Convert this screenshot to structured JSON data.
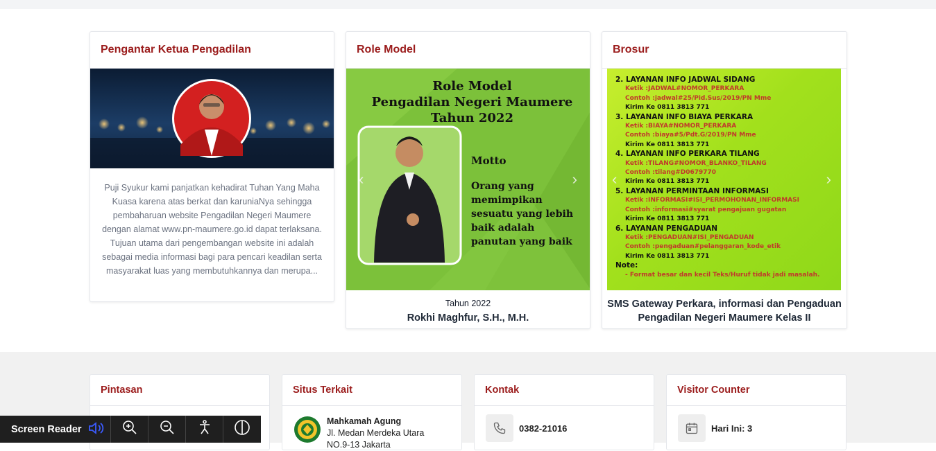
{
  "cards": {
    "pengantar": {
      "title": "Pengantar Ketua Pengadilan",
      "text": "Puji Syukur kami panjatkan kehadirat Tuhan Yang Maha Kuasa karena atas berkat dan karuniaNya sehingga pembaharuan website Pengadilan Negeri Maumere dengan alamat www.pn-maumere.go.id dapat terlaksana. Tujuan utama dari pengembangan website ini adalah sebagai media informasi bagi para pencari keadilan serta masyarakat luas yang membutuhkannya dan merupa..."
    },
    "role_model": {
      "title": "Role Model",
      "banner_line1": "Role Model",
      "banner_line2": "Pengadilan Negeri Maumere",
      "banner_line3": "Tahun 2022",
      "motto_label": "Motto",
      "motto_text": "Orang yang memimpikan sesuatu yang lebih baik adalah panutan yang baik",
      "caption_year": "Tahun 2022",
      "caption_name": "Rokhi Maghfur, S.H., M.H."
    },
    "brosur": {
      "title": "Brosur",
      "lines": [
        "2. LAYANAN INFO JADWAL SIDANG",
        "Ketik     :JADWAL#NOMOR_PERKARA",
        "Contoh  :jadwal#25/Pid.Sus/2019/PN Mme",
        "Kirim Ke 0811 3813 771",
        "3. LAYANAN INFO BIAYA PERKARA",
        "Ketik     :BIAYA#NOMOR_PERKARA",
        "Contoh  :biaya#5/Pdt.G/2019/PN Mme",
        "Kirim Ke 0811 3813 771",
        "4. LAYANAN INFO PERKARA TILANG",
        "Ketik     :TILANG#NOMOR_BLANKO_TILANG",
        "Contoh  :tilang#D0679770",
        "Kirim Ke 0811 3813 771",
        "5. LAYANAN PERMINTAAN INFORMASI",
        "Ketik     :INFORMASI#ISI_PERMOHONAN_INFORMASI",
        "Contoh  :informasi#syarat pengajuan gugatan",
        "Kirim Ke 0811 3813 771",
        "6. LAYANAN PENGADUAN",
        "Ketik     :PENGADUAN#ISI_PENGADUAN",
        "Contoh  :pengaduan#pelanggaran_kode_etik",
        "Kirim Ke 0811 3813 771",
        "Note:",
        "- Format besar dan kecil Teks/Huruf tidak jadi masalah."
      ],
      "caption": "SMS Gateway Perkara, informasi dan Pengaduan Pengadilan Negeri Maumere Kelas II"
    }
  },
  "footer": {
    "pintasan": {
      "title": "Pintasan"
    },
    "situs": {
      "title": "Situs Terkait",
      "item_name": "Mahkamah Agung",
      "item_addr1": "Jl. Medan Merdeka Utara",
      "item_addr2": "NO.9-13 Jakarta"
    },
    "kontak": {
      "title": "Kontak",
      "phone": "0382-21016"
    },
    "visitor": {
      "title": "Visitor Counter",
      "today": "Hari Ini: 3"
    }
  },
  "screen_reader": {
    "label": "Screen Reader"
  },
  "colors": {
    "title_red": "#9b1c1c",
    "brosur_green": "#a6e61b",
    "role_green": "#7fc43a"
  }
}
